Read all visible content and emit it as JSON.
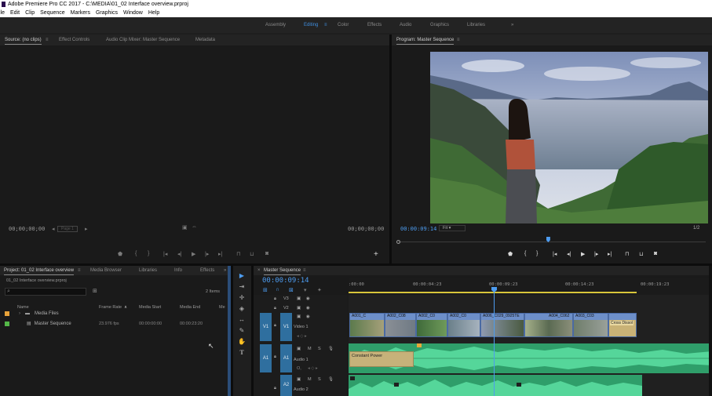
{
  "window": {
    "title": "Adobe Premiere Pro CC 2017 - C:\\MEDIA\\01_02 Interface overview.prproj"
  },
  "menu": [
    "ile",
    "Edit",
    "Clip",
    "Sequence",
    "Markers",
    "Graphics",
    "Window",
    "Help"
  ],
  "workspaces": {
    "items": [
      "Assembly",
      "Editing",
      "Color",
      "Effects",
      "Audio",
      "Graphics",
      "Libraries"
    ],
    "active": "Editing",
    "more": "»"
  },
  "source": {
    "tabs": [
      "Source: (no clips)",
      "Effect Controls",
      "Audio Clip Mixer: Master Sequence",
      "Metadata"
    ],
    "timecode_left": "00;00;00;00",
    "page": "Page 1",
    "timecode_right": "00;00;00;00"
  },
  "program": {
    "tab": "Program: Master Sequence",
    "timecode": "00:00:09:14",
    "fit": "Fit",
    "playhead_fraction": 0.487
  },
  "project": {
    "tabs": [
      "Project: 01_02 Interface overview",
      "Media Browser",
      "Libraries",
      "Info",
      "Effects"
    ],
    "filename": "01_02 Interface overview.prproj",
    "item_count": "2 Items",
    "columns": [
      "Name",
      "Frame Rate",
      "Media Start",
      "Media End",
      "Me"
    ],
    "rows": [
      {
        "name": "Media Files",
        "color": "#e8a33a",
        "frame_rate": "",
        "start": "",
        "end": ""
      },
      {
        "name": "Master Sequence",
        "color": "#54b848",
        "frame_rate": "23.976 fps",
        "start": "00:00:00:00",
        "end": "00:00:23:20"
      }
    ]
  },
  "timeline": {
    "tab": "Master Sequence",
    "timecode": "00:00:09:14",
    "ruler": [
      ":00:00",
      "00:00:04:23",
      "00:00:09:23",
      "00:00:14:23",
      "00:00:19:23"
    ],
    "tracks_video": [
      {
        "name": "V3"
      },
      {
        "name": "V2"
      },
      {
        "name": "V1",
        "label": "Video 1"
      }
    ],
    "tracks_audio": [
      {
        "name": "A1",
        "label": "Audio 1"
      },
      {
        "name": "A2",
        "label": "Audio 2"
      }
    ],
    "clips": [
      "A001_C",
      "A002_C08",
      "A002_C0",
      "A002_C0",
      "A006_C029_0925TE",
      "A004_C062",
      "A003_C03"
    ],
    "title_clip": "Cross Dissol",
    "audio_clip": "Constant Power"
  },
  "colors": {
    "accent": "#3f8fe0",
    "video_clip": "#6d8fc9",
    "audio_clip": "#3fb57a"
  },
  "icons": [
    "pr-logo",
    "wrench-icon",
    "magnet-icon",
    "marker-icon",
    "selection-tool-icon",
    "track-select-icon",
    "ripple-edit-icon",
    "razor-icon",
    "slip-icon",
    "pen-icon",
    "hand-icon",
    "type-icon",
    "lock-icon",
    "eye-icon",
    "mic-icon",
    "play-icon",
    "step-back-icon",
    "step-forward-icon",
    "camera-icon",
    "plus-icon"
  ]
}
